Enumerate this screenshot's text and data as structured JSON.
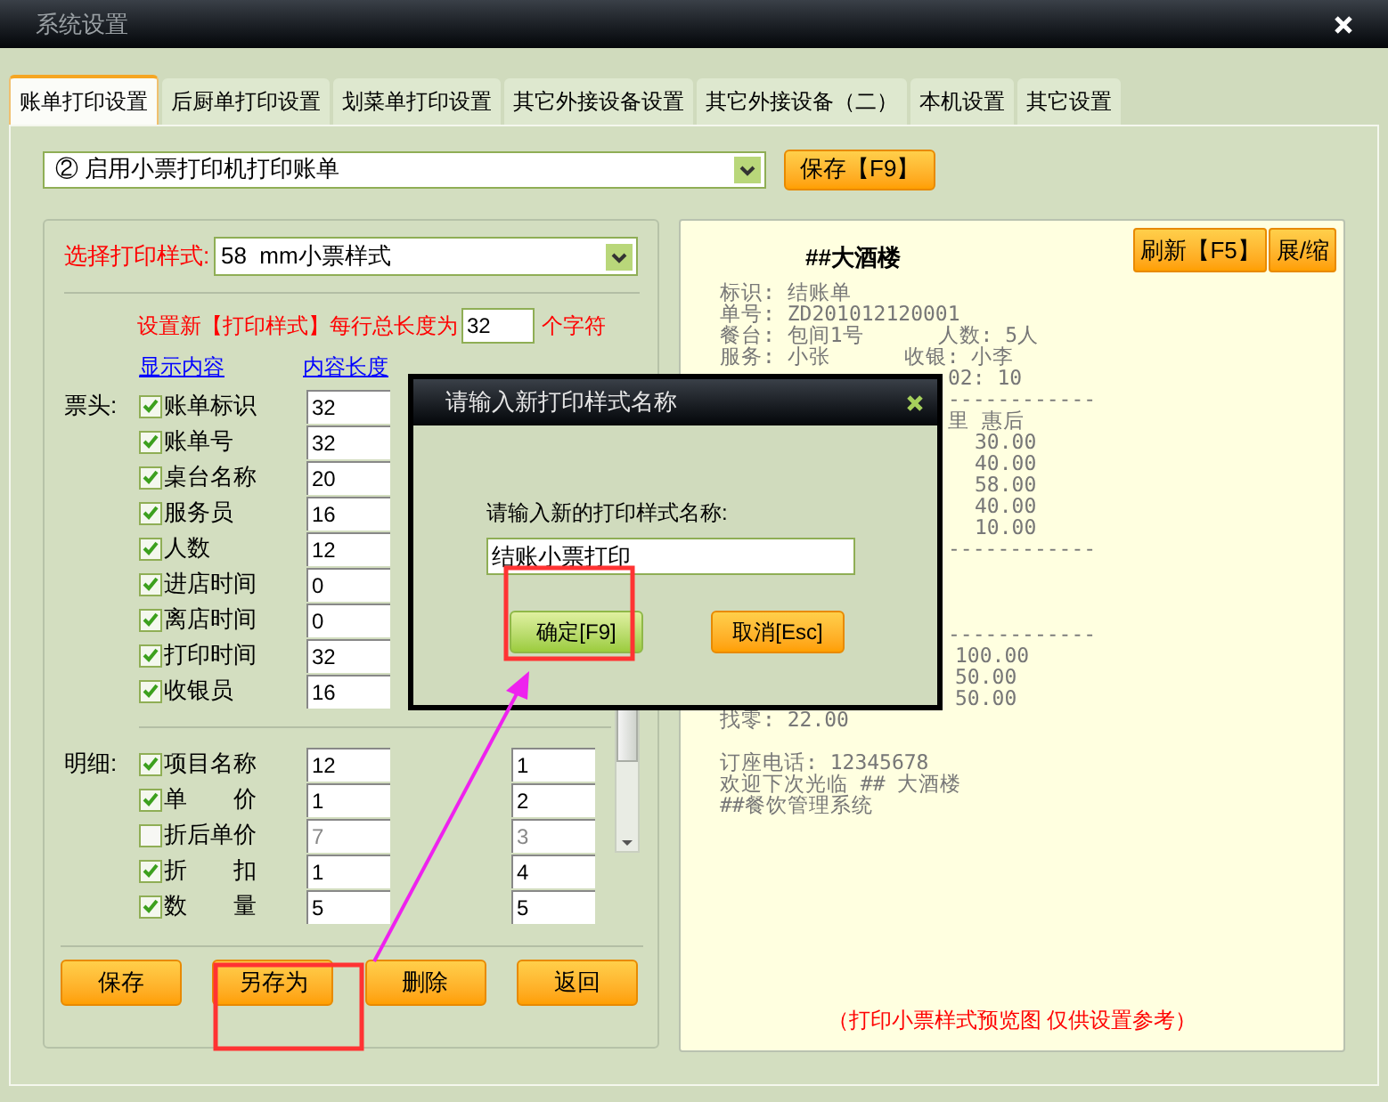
{
  "window": {
    "title": "系统设置"
  },
  "tabs": [
    {
      "label": "账单打印设置",
      "selected": true
    },
    {
      "label": "后厨单打印设置",
      "selected": false
    },
    {
      "label": "划菜单打印设置",
      "selected": false
    },
    {
      "label": "其它外接设备设置",
      "selected": false
    },
    {
      "label": "其它外接设备（二）",
      "selected": false
    },
    {
      "label": "本机设置",
      "selected": false
    },
    {
      "label": "其它设置",
      "selected": false
    }
  ],
  "mode_select": {
    "value": "② 启用小票打印机打印账单"
  },
  "save_button": "保存【F9】",
  "style_select": {
    "label": "选择打印样式:",
    "value": "58  mm小票样式"
  },
  "line_length": {
    "prefix": "设置新【打印样式】每行总长度为",
    "value": "32",
    "suffix": "个字符"
  },
  "columns": [
    "显示内容",
    "内容长度"
  ],
  "sections": [
    {
      "label": "票头:",
      "rows": [
        {
          "name": "账单标识",
          "checked": true,
          "length": "32"
        },
        {
          "name": "账单号",
          "checked": true,
          "length": "32"
        },
        {
          "name": "桌台名称",
          "checked": true,
          "length": "20"
        },
        {
          "name": "服务员",
          "checked": true,
          "length": "16"
        },
        {
          "name": "人数",
          "checked": true,
          "length": "12"
        },
        {
          "name": "进店时间",
          "checked": true,
          "length": "0"
        },
        {
          "name": "离店时间",
          "checked": true,
          "length": "0"
        },
        {
          "name": "打印时间",
          "checked": true,
          "length": "32"
        },
        {
          "name": "收银员",
          "checked": true,
          "length": "16"
        }
      ]
    },
    {
      "label": "明细:",
      "rows": [
        {
          "name": "项目名称",
          "checked": true,
          "length": "12",
          "column_4": "1"
        },
        {
          "name": "单　　价",
          "checked": true,
          "length": "1",
          "column_4": "2"
        },
        {
          "name": "折后单价",
          "checked": false,
          "length": "7",
          "column_4": "3"
        },
        {
          "name": "折　　扣",
          "checked": true,
          "length": "1",
          "column_4": "4"
        },
        {
          "name": "数　　量",
          "checked": true,
          "length": "5",
          "column_4": "5"
        }
      ]
    }
  ],
  "buttons": [
    "保存",
    "另存为",
    "删除",
    "返回"
  ],
  "preview": {
    "title": "##大酒楼",
    "buttons": [
      "刷新【F5】",
      "展/缩"
    ],
    "blocks": [
      [
        {
          "kind": "line",
          "text": "标识: 结账单"
        },
        {
          "kind": "line",
          "text": "单号: ZD201012120001"
        },
        {
          "kind": "line",
          "text": "餐台: 包间1号      人数: 5人"
        },
        {
          "kind": "line",
          "text": "服务: 小张      收银: 小李"
        },
        {
          "kind": "fragment",
          "text": "02: 10"
        },
        {
          "kind": "fragment",
          "text": "------------"
        },
        {
          "kind": "fragment",
          "text": "里 惠后"
        },
        {
          "kind": "amount",
          "text": "30.00"
        },
        {
          "kind": "amount",
          "text": "40.00"
        },
        {
          "kind": "amount",
          "text": "58.00"
        },
        {
          "kind": "amount",
          "text": "40.00"
        },
        {
          "kind": "amount",
          "text": "10.00"
        },
        {
          "kind": "fragment",
          "text": "------------"
        }
      ],
      [
        {
          "kind": "fragment",
          "text": "------------"
        },
        {
          "kind": "total",
          "text": "100.00"
        },
        {
          "kind": "total",
          "text": "50.00"
        },
        {
          "kind": "total",
          "text": "50.00"
        },
        {
          "kind": "line",
          "text": "找零: 22.00"
        }
      ],
      [
        {
          "kind": "line",
          "text": "订座电话: 12345678"
        },
        {
          "kind": "line",
          "text": "欢迎下次光临 ## 大酒楼"
        },
        {
          "kind": "line",
          "text": "##餐饮管理系统"
        }
      ]
    ],
    "note": "（打印小票样式预览图 仅供设置参考）"
  },
  "dialog": {
    "title": "请输入新打印样式名称",
    "prompt": "请输入新的打印样式名称:",
    "value": "结账小票打印",
    "buttons": [
      {
        "label": "确定[F9]",
        "kind": "confirm"
      },
      {
        "label": "取消[Esc]",
        "kind": "cancel"
      }
    ]
  }
}
